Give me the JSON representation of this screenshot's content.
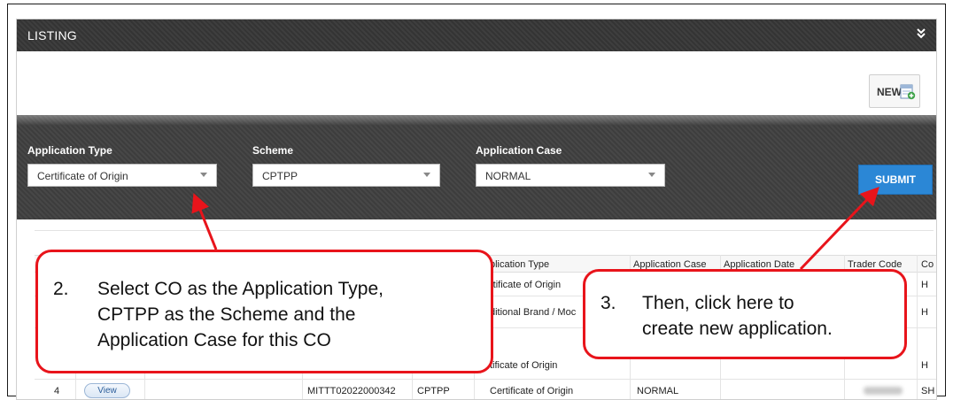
{
  "panel": {
    "title": "LISTING",
    "collapse_icon": "double-chevron-down-icon"
  },
  "toolbar": {
    "new_label": "NEW",
    "new_icon": "new-document-icon"
  },
  "filters": {
    "application_type": {
      "label": "Application Type",
      "value": "Certificate of Origin"
    },
    "scheme": {
      "label": "Scheme",
      "value": "CPTPP"
    },
    "application_case": {
      "label": "Application Case",
      "value": "NORMAL"
    },
    "submit_label": "SUBMIT",
    "submit_color": "#2b87d6"
  },
  "table": {
    "headers": {
      "application_type": "plication Type",
      "application_case": "Application Case",
      "application_date": "Application Date",
      "trader_code": "Trader Code",
      "co": "Co"
    },
    "rows": [
      {
        "application_type": "rtificate of Origin",
        "co": "H"
      },
      {
        "application_type": "ditional Brand / Moc",
        "co": "H"
      },
      {
        "application_type": "tificate of Origin",
        "co": "H"
      },
      {
        "index": "4",
        "view_label": "View",
        "application_no": "MITTT02022000342",
        "scheme": "CPTPP",
        "application_type": "Certificate of Origin",
        "application_case": "NORMAL",
        "co": "SH"
      }
    ]
  },
  "callouts": {
    "select": {
      "number": "2.",
      "lines": [
        "Select CO as the Application Type,",
        "CPTPP as the Scheme and the",
        "Application Case for this CO"
      ]
    },
    "submit": {
      "number": "3.",
      "lines": [
        "Then, click here to",
        "create new application."
      ]
    },
    "accent_color": "#e8141b"
  }
}
